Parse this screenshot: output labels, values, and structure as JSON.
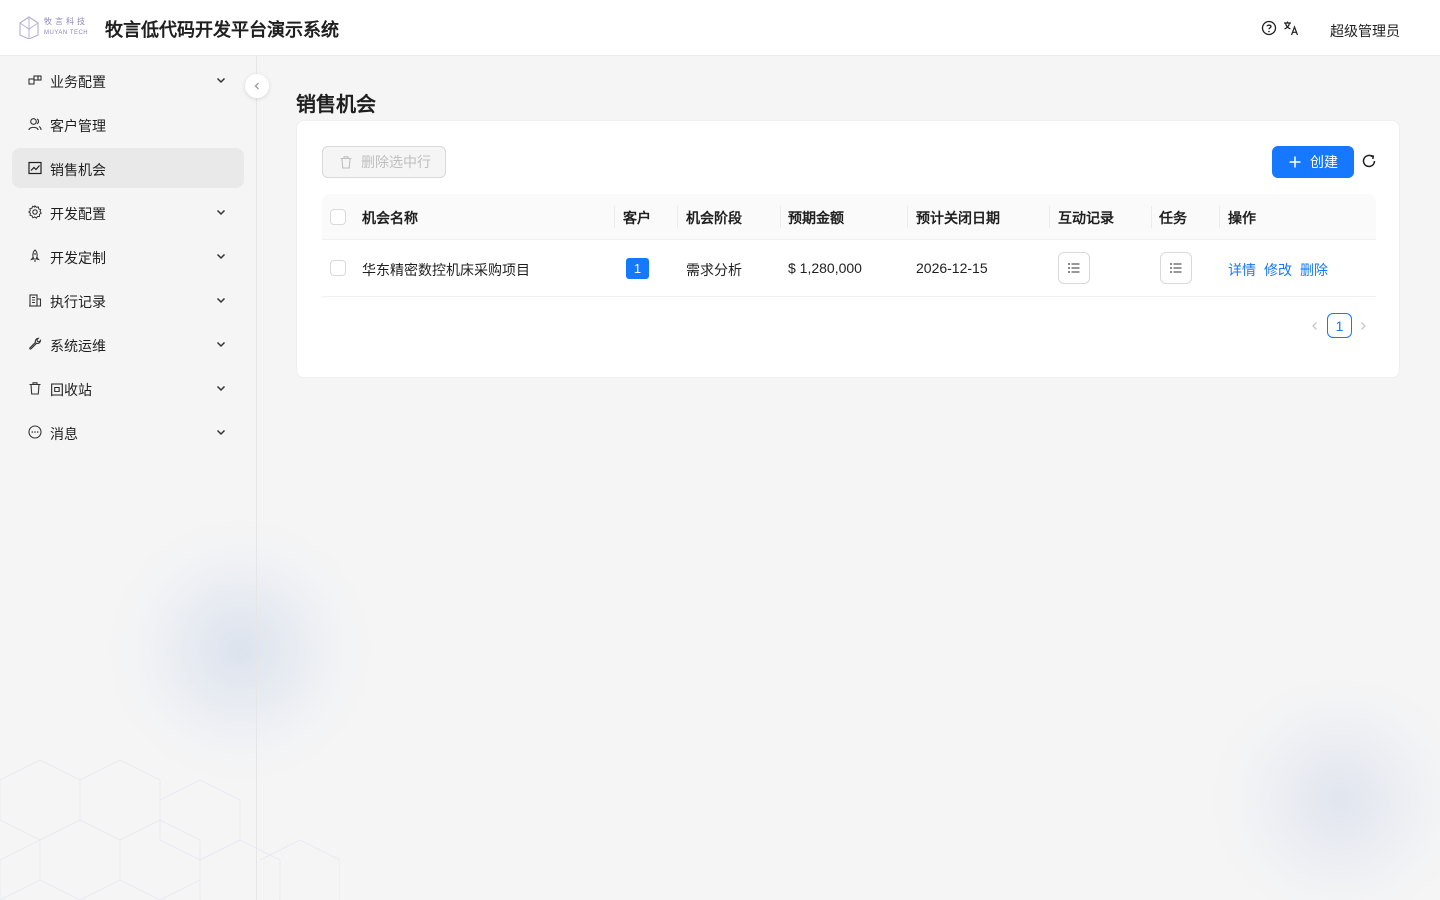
{
  "header": {
    "logo_cn": "牧言科技",
    "logo_en": "MUYAN TECH",
    "title": "牧言低代码开发平台演示系统",
    "user": "超级管理员"
  },
  "sidebar": {
    "items": [
      {
        "label": "业务配置",
        "icon": "building-blocks-icon",
        "expandable": true
      },
      {
        "label": "客户管理",
        "icon": "users-icon",
        "expandable": false
      },
      {
        "label": "销售机会",
        "icon": "line-chart-icon",
        "expandable": false,
        "active": true
      },
      {
        "label": "开发配置",
        "icon": "gear-icon",
        "expandable": true
      },
      {
        "label": "开发定制",
        "icon": "rocket-icon",
        "expandable": true
      },
      {
        "label": "执行记录",
        "icon": "building-icon",
        "expandable": true
      },
      {
        "label": "系统运维",
        "icon": "wrench-icon",
        "expandable": true
      },
      {
        "label": "回收站",
        "icon": "trash-icon",
        "expandable": true
      },
      {
        "label": "消息",
        "icon": "message-icon",
        "expandable": true
      }
    ]
  },
  "page": {
    "title": "销售机会"
  },
  "toolbar": {
    "delete_label": "删除选中行",
    "create_label": "创建"
  },
  "table": {
    "columns": [
      "机会名称",
      "客户",
      "机会阶段",
      "预期金额",
      "预计关闭日期",
      "互动记录",
      "任务",
      "操作"
    ],
    "rows": [
      {
        "name": "华东精密数控机床采购项目",
        "customer": "1",
        "stage": "需求分析",
        "amount": "$ 1,280,000",
        "close_date": "2026-12-15",
        "actions": [
          "详情",
          "修改",
          "删除"
        ]
      }
    ]
  },
  "pagination": {
    "current": "1"
  },
  "colors": {
    "primary": "#1677ff",
    "active_menu_bg": "#e9e9e9",
    "page_bg": "#f5f5f5"
  }
}
